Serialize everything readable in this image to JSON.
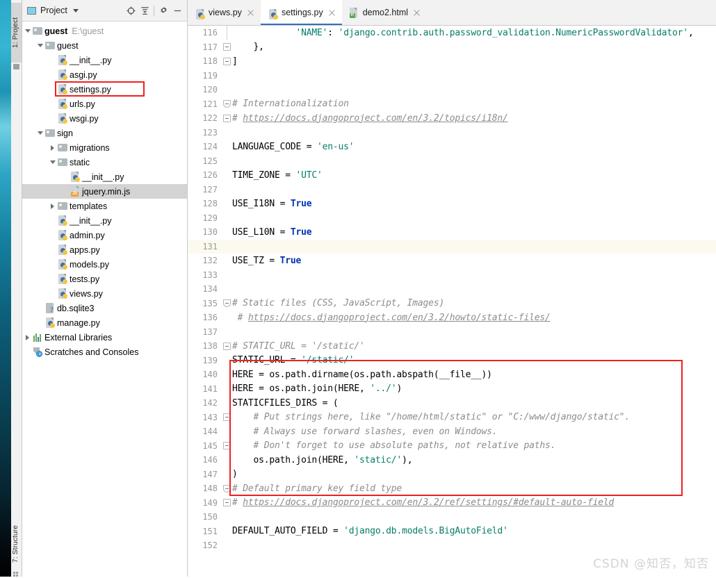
{
  "left_tool_bar": {
    "project_tab": "1: Project",
    "structure_tab": "7: Structure"
  },
  "project_panel": {
    "title": "Project",
    "toolbar": {
      "locate": "locate-icon",
      "collapse_all": "collapse-all-icon",
      "settings": "gear-icon",
      "hide": "minimize-icon"
    },
    "tree": [
      {
        "label": "guest",
        "path": "E:\\guest",
        "icon": "folder-icon",
        "indent": 0,
        "arrow": "open",
        "bold": true,
        "selected": false
      },
      {
        "label": "guest",
        "path": "",
        "icon": "folder-icon",
        "indent": 1,
        "arrow": "open",
        "bold": false,
        "selected": false
      },
      {
        "label": "__init__.py",
        "path": "",
        "icon": "python-file-icon",
        "indent": 2,
        "arrow": "none",
        "bold": false,
        "selected": false
      },
      {
        "label": "asgi.py",
        "path": "",
        "icon": "python-file-icon",
        "indent": 2,
        "arrow": "none",
        "bold": false,
        "selected": false
      },
      {
        "label": "settings.py",
        "path": "",
        "icon": "python-file-icon",
        "indent": 2,
        "arrow": "none",
        "bold": false,
        "selected": false
      },
      {
        "label": "urls.py",
        "path": "",
        "icon": "python-file-icon",
        "indent": 2,
        "arrow": "none",
        "bold": false,
        "selected": false
      },
      {
        "label": "wsgi.py",
        "path": "",
        "icon": "python-file-icon",
        "indent": 2,
        "arrow": "none",
        "bold": false,
        "selected": false
      },
      {
        "label": "sign",
        "path": "",
        "icon": "folder-icon",
        "indent": 1,
        "arrow": "open",
        "bold": false,
        "selected": false
      },
      {
        "label": "migrations",
        "path": "",
        "icon": "folder-icon",
        "indent": 2,
        "arrow": "closed",
        "bold": false,
        "selected": false
      },
      {
        "label": "static",
        "path": "",
        "icon": "folder-icon",
        "indent": 2,
        "arrow": "open",
        "bold": false,
        "selected": false
      },
      {
        "label": "__init__.py",
        "path": "",
        "icon": "python-file-icon",
        "indent": 3,
        "arrow": "none",
        "bold": false,
        "selected": false
      },
      {
        "label": "jquery.min.js",
        "path": "",
        "icon": "js-file-icon",
        "indent": 3,
        "arrow": "none",
        "bold": false,
        "selected": true
      },
      {
        "label": "templates",
        "path": "",
        "icon": "folder-icon",
        "indent": 2,
        "arrow": "closed",
        "bold": false,
        "selected": false
      },
      {
        "label": "__init__.py",
        "path": "",
        "icon": "python-file-icon",
        "indent": 2,
        "arrow": "none",
        "bold": false,
        "selected": false
      },
      {
        "label": "admin.py",
        "path": "",
        "icon": "python-file-icon",
        "indent": 2,
        "arrow": "none",
        "bold": false,
        "selected": false
      },
      {
        "label": "apps.py",
        "path": "",
        "icon": "python-file-icon",
        "indent": 2,
        "arrow": "none",
        "bold": false,
        "selected": false
      },
      {
        "label": "models.py",
        "path": "",
        "icon": "python-file-icon",
        "indent": 2,
        "arrow": "none",
        "bold": false,
        "selected": false
      },
      {
        "label": "tests.py",
        "path": "",
        "icon": "python-file-icon",
        "indent": 2,
        "arrow": "none",
        "bold": false,
        "selected": false
      },
      {
        "label": "views.py",
        "path": "",
        "icon": "python-file-icon",
        "indent": 2,
        "arrow": "none",
        "bold": false,
        "selected": false
      },
      {
        "label": "db.sqlite3",
        "path": "",
        "icon": "db-file-icon",
        "indent": 1,
        "arrow": "none",
        "bold": false,
        "selected": false
      },
      {
        "label": "manage.py",
        "path": "",
        "icon": "python-file-icon",
        "indent": 1,
        "arrow": "none",
        "bold": false,
        "selected": false
      },
      {
        "label": "External Libraries",
        "path": "",
        "icon": "external-libraries-icon",
        "indent": 0,
        "arrow": "closed",
        "bold": false,
        "selected": false
      },
      {
        "label": "Scratches and Consoles",
        "path": "",
        "icon": "scratches-icon",
        "indent": 0,
        "arrow": "none",
        "bold": false,
        "selected": false
      }
    ]
  },
  "editor_tabs": [
    {
      "label": "views.py",
      "icon": "python-file-icon",
      "active": false
    },
    {
      "label": "settings.py",
      "icon": "python-file-icon",
      "active": true
    },
    {
      "label": "demo2.html",
      "icon": "html-file-icon",
      "active": false
    }
  ],
  "editor": {
    "current_line": 131,
    "first_line": 116,
    "lines": [
      {
        "n": 116,
        "fold": "vline",
        "html": "            <span class='str'>'NAME'</span>: <span class='str'>'django.contrib.auth.password_validation.NumericPasswordValidator'</span>,"
      },
      {
        "n": 117,
        "fold": "box",
        "html": "    },"
      },
      {
        "n": 118,
        "fold": "box",
        "html": "]"
      },
      {
        "n": 119,
        "fold": "none",
        "html": ""
      },
      {
        "n": 120,
        "fold": "none",
        "html": ""
      },
      {
        "n": 121,
        "fold": "boxdown",
        "html": "<span class='cmt'># Internationalization</span>"
      },
      {
        "n": 122,
        "fold": "box",
        "html": "<span class='cmt'># </span><span class='lnk'>https://docs.djangoproject.com/en/3.2/topics/i18n/</span>"
      },
      {
        "n": 123,
        "fold": "none",
        "html": ""
      },
      {
        "n": 124,
        "fold": "none",
        "html": "LANGUAGE_CODE = <span class='str'>'en-us'</span>"
      },
      {
        "n": 125,
        "fold": "none",
        "html": ""
      },
      {
        "n": 126,
        "fold": "none",
        "html": "TIME_ZONE = <span class='str'>'UTC'</span>"
      },
      {
        "n": 127,
        "fold": "none",
        "html": ""
      },
      {
        "n": 128,
        "fold": "none",
        "html": "USE_I18N = <span class='kw'>True</span>"
      },
      {
        "n": 129,
        "fold": "none",
        "html": ""
      },
      {
        "n": 130,
        "fold": "none",
        "html": "USE_L10N = <span class='kw'>True</span>"
      },
      {
        "n": 131,
        "fold": "none",
        "html": ""
      },
      {
        "n": 132,
        "fold": "none",
        "html": "USE_TZ = <span class='kw'>True</span>"
      },
      {
        "n": 133,
        "fold": "none",
        "html": ""
      },
      {
        "n": 134,
        "fold": "none",
        "html": ""
      },
      {
        "n": 135,
        "fold": "boxdown",
        "html": "<span class='cmt'># Static files (CSS, JavaScript, Images)</span>"
      },
      {
        "n": 136,
        "fold": "none",
        "html": " <span class='cmt'># </span><span class='lnk'>https://docs.djangoproject.com/en/3.2/howto/static-files/</span>"
      },
      {
        "n": 137,
        "fold": "none",
        "html": ""
      },
      {
        "n": 138,
        "fold": "box",
        "html": "<span class='cmt'># STATIC_URL = '/static/'</span>"
      },
      {
        "n": 139,
        "fold": "none",
        "html": "STATIC_URL = <span class='str'>'/static/'</span>"
      },
      {
        "n": 140,
        "fold": "none",
        "html": "HERE = os.path.dirname(os.path.abspath(__file__))"
      },
      {
        "n": 141,
        "fold": "none",
        "html": "HERE = os.path.join(HERE, <span class='str'>'../'</span>)"
      },
      {
        "n": 142,
        "fold": "none",
        "html": "STATICFILES_DIRS = ("
      },
      {
        "n": 143,
        "fold": "box",
        "html": "    <span class='cmt'># Put strings here, like \"/home/html/static\" or \"C:/www/django/static\".</span>"
      },
      {
        "n": 144,
        "fold": "none",
        "html": "    <span class='cmt'># Always use forward slashes, even on Windows.</span>"
      },
      {
        "n": 145,
        "fold": "box",
        "html": "    <span class='cmt'># Don't forget to use absolute paths, not relative paths.</span>"
      },
      {
        "n": 146,
        "fold": "none",
        "html": "    os.path.join(HERE, <span class='str'>'static/'</span>),"
      },
      {
        "n": 147,
        "fold": "none",
        "html": ")"
      },
      {
        "n": 148,
        "fold": "boxdown",
        "html": "<span class='cmt'># Default primary key field type</span>"
      },
      {
        "n": 149,
        "fold": "box",
        "html": "<span class='cmt'># </span><span class='lnk'>https://docs.djangoproject.com/en/3.2/ref/settings/#default-auto-field</span>"
      },
      {
        "n": 150,
        "fold": "none",
        "html": ""
      },
      {
        "n": 151,
        "fold": "none",
        "html": "DEFAULT_AUTO_FIELD = <span class='str'>'django.db.models.BigAutoField'</span>"
      },
      {
        "n": 152,
        "fold": "none",
        "html": ""
      }
    ]
  },
  "annotations": {
    "tree_highlight_target": "settings.py",
    "code_highlight_lines": "139-147",
    "highlight_color": "#f21f1f"
  },
  "watermark": "CSDN @知否，知否"
}
